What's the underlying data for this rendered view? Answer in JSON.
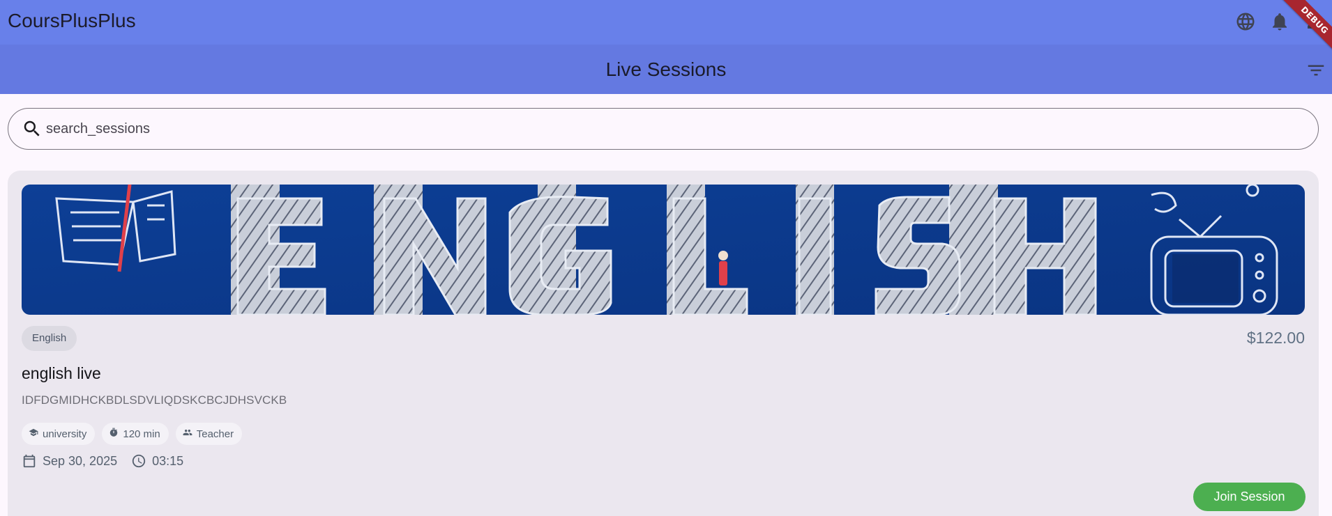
{
  "app": {
    "title": "CoursPlusPlus",
    "debug_label": "DEBUG"
  },
  "header": {
    "title": "Live Sessions"
  },
  "search": {
    "placeholder": "search_sessions"
  },
  "session": {
    "subject": "English",
    "price": "$122.00",
    "title": "english live",
    "description": "IDFDGMIDHCKBDLSDVLIQDSKCBCJDHSVCKB",
    "level": "university",
    "duration": "120 min",
    "type": "Teacher",
    "date": "Sep 30, 2025",
    "time": "03:15",
    "join_label": "Join Session",
    "banner_text": "ENGLISH"
  },
  "icons": {
    "appbar": [
      "globe-icon",
      "bell-icon"
    ],
    "filter": "filter-icon",
    "search": "search-icon",
    "meta": [
      "school-icon",
      "timer-icon",
      "people-icon"
    ],
    "date": [
      "calendar-icon",
      "clock-icon"
    ]
  },
  "colors": {
    "appbar": "#6880ea",
    "subbar": "#6479e1",
    "card": "#ebe7ef",
    "join_button": "#4caf50",
    "banner_bg": "#0c3a8f",
    "debug_ribbon": "#a8262f"
  }
}
